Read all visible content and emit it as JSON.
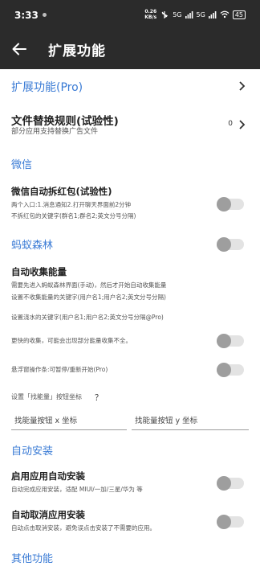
{
  "status_bar": {
    "time": "3:33",
    "net_speed_value": "0.26",
    "net_speed_unit": "KB/s",
    "signal_1": "5G",
    "signal_2": "5G",
    "battery": "45"
  },
  "app_bar": {
    "title": "扩展功能",
    "back_icon": "arrow-left-icon"
  },
  "colors": {
    "accent": "#3a7bd5",
    "bar": "#2b2b2b"
  },
  "items": {
    "ext_pro": {
      "label": "扩展功能(Pro)"
    },
    "file_replace": {
      "title": "文件替换规则(试验性)",
      "subtitle": "部分应用支持替换广告文件",
      "value": "0"
    },
    "wechat_section": "微信",
    "wechat_redpacket": {
      "title": "微信自动拆红包(试验性)",
      "line1": "两个入口:1.消息通知2.打开聊天界面前2分钟",
      "line2": "不拆红包的关键字(群名1;群名2;英文分号分隔)"
    },
    "antforest_section": "蚂蚁森林",
    "auto_collect": {
      "title": "自动收集能量",
      "line1": "需要先进入蚂蚁森林界面(手动)，然后才开始自动收集能量",
      "line2": "设置不收集能量的关键字(用户名1;用户名2;英文分号分隔)"
    },
    "water_keyword": "设置浇水的关键字(用户名1;用户名2;英文分号分隔@Pro)",
    "faster_collect": "更快的收集，可能会出现部分能量收集不全。",
    "float_window": "悬浮窗操作条:可暂停/重新开始(Pro)",
    "find_energy": {
      "label": "设置「找能量」按钮坐标",
      "help": "？"
    },
    "coord_inputs": {
      "x_placeholder": "找能量按钮 x 坐标",
      "y_placeholder": "找能量按钮 y 坐标"
    },
    "auto_install_section": "自动安装",
    "enable_auto_install": {
      "title": "启用应用自动安装",
      "subtitle": "自动完成应用安装，适配 MIUI/一加/三星/华为 等"
    },
    "auto_cancel_install": {
      "title": "自动取消应用安装",
      "subtitle": "自动点击取消安装，避免误点击安装了不需要的应用。"
    },
    "other_section": "其他功能"
  },
  "toggles": {
    "wechat_redpacket": false,
    "antforest": false,
    "faster_collect": false,
    "float_window": false,
    "enable_auto_install": false,
    "auto_cancel_install": false
  }
}
